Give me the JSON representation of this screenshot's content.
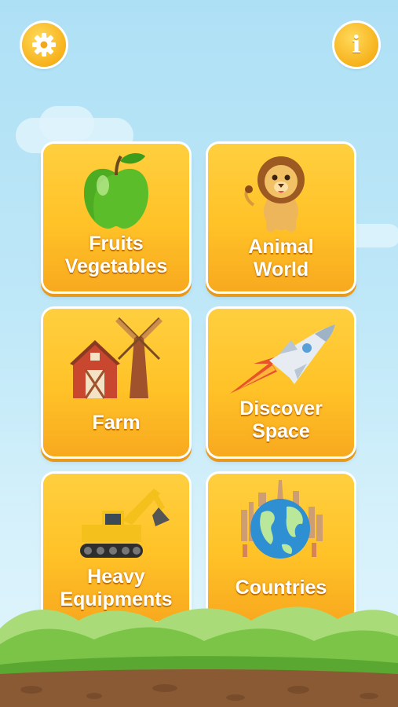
{
  "header": {
    "settings_icon": "gear-icon",
    "info_icon": "info-icon",
    "info_glyph": "i"
  },
  "categories": [
    {
      "line1": "Fruits",
      "line2": "Vegetables",
      "icon": "green-apple"
    },
    {
      "line1": "Animal",
      "line2": "World",
      "icon": "lion"
    },
    {
      "line1": "Farm",
      "line2": "",
      "icon": "barn-windmill"
    },
    {
      "line1": "Discover",
      "line2": "Space",
      "icon": "rocket"
    },
    {
      "line1": "Heavy",
      "line2": "Equipments",
      "icon": "excavator"
    },
    {
      "line1": "Countries",
      "line2": "",
      "icon": "globe-landmarks"
    }
  ],
  "colors": {
    "tile": "#ffc227",
    "tile_shadow": "#e89a1c",
    "sky": "#bfe8f8",
    "grass": "#7cc447",
    "soil": "#8a5a34"
  }
}
